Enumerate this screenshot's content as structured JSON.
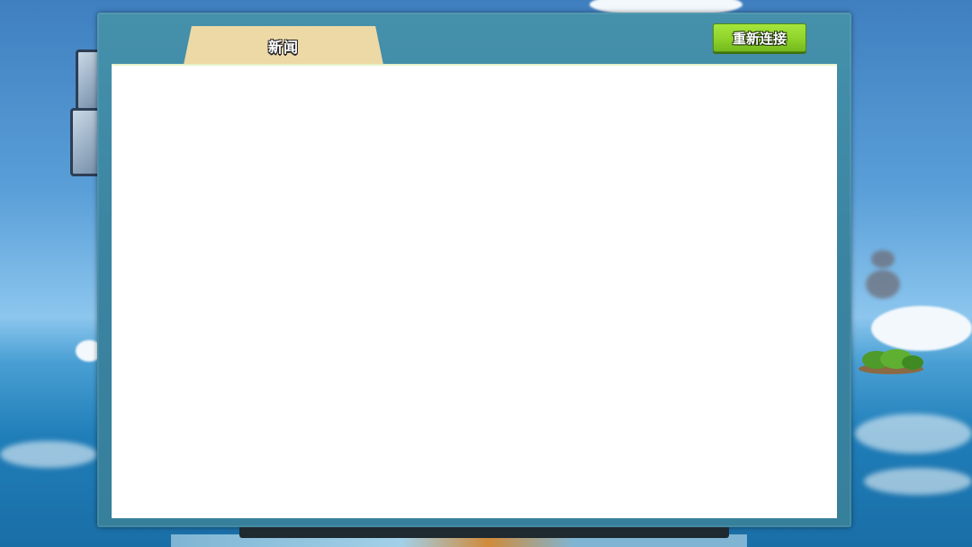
{
  "dialog": {
    "tabs": [
      {
        "label": "新闻",
        "active": true
      }
    ],
    "reconnect_button": {
      "label": "重新连接"
    },
    "content": {
      "text": ""
    }
  },
  "colors": {
    "frame": "#3d8aa6",
    "tab": "#ecd9a6",
    "button": "#8ed22b",
    "panel": "#ffffff"
  }
}
